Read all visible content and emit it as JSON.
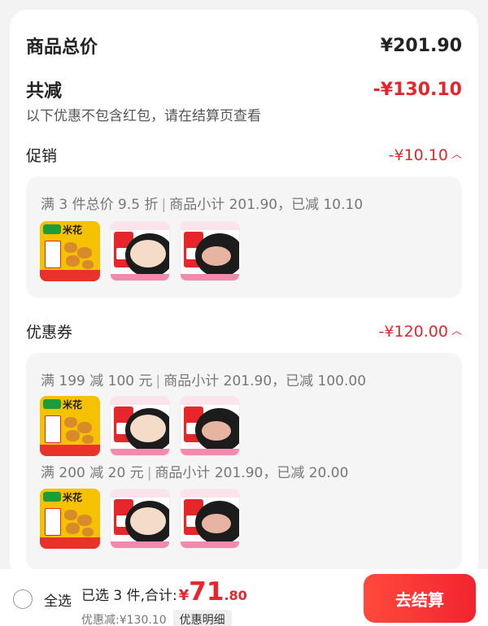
{
  "summary": {
    "total_label": "商品总价",
    "total_value": "¥201.90",
    "discount_label": "共减",
    "discount_value": "-¥130.10",
    "note": "以下优惠不包含红包，请在结算页查看"
  },
  "promotion": {
    "title": "促销",
    "amount": "-¥10.10",
    "rule": "满 3 件总价 9.5 折",
    "detail": "商品小计 201.90，已减 10.10"
  },
  "coupons": {
    "title": "优惠券",
    "amount": "-¥120.00",
    "items": [
      {
        "rule": "满 199 减 100 元",
        "detail": "商品小计 201.90，已减 100.00"
      },
      {
        "rule": "满 200 减 20 元",
        "detail": "商品小计 201.90，已减 20.00"
      }
    ]
  },
  "products": [
    {
      "word": "米花",
      "icon": "popcorn-chicken-product"
    },
    {
      "word": "",
      "icon": "chicken-breast-product"
    },
    {
      "word": "",
      "icon": "pork-tenderloin-product"
    }
  ],
  "bottom_bar": {
    "select_all": "全选",
    "selected_text": "已选 3 件,合计:",
    "currency": "¥",
    "total_int": "71",
    "total_dec": ".80",
    "discount_text": "优惠减:¥130.10",
    "detail_button": "优惠明细",
    "checkout_button": "去结算"
  },
  "colors": {
    "accent_red": "#e6262b",
    "checkout_gradient_start": "#ff4a3d",
    "checkout_gradient_end": "#f2242e"
  }
}
